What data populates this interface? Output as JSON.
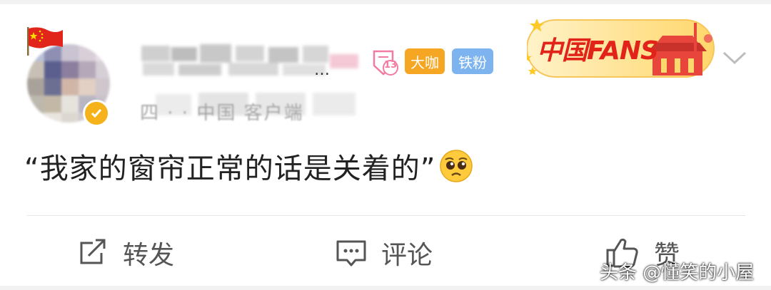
{
  "post": {
    "name_ellipsis": "…",
    "meta": "四 ·  · 中国  客户端",
    "level_badge": "13",
    "tags": [
      "大咖",
      "铁粉"
    ],
    "banner_text": "中国FANS",
    "content": "“我家的窗帘正常的话是关着的”"
  },
  "actions": {
    "repost": "转发",
    "comment": "评论",
    "like": "赞"
  },
  "watermark": "头条 @懂笑的小屋",
  "colors": {
    "tag_orange": "#f5a623",
    "tag_blue": "#7db4ef",
    "banner_red": "#e2231a",
    "verified": "#f6b21a"
  }
}
